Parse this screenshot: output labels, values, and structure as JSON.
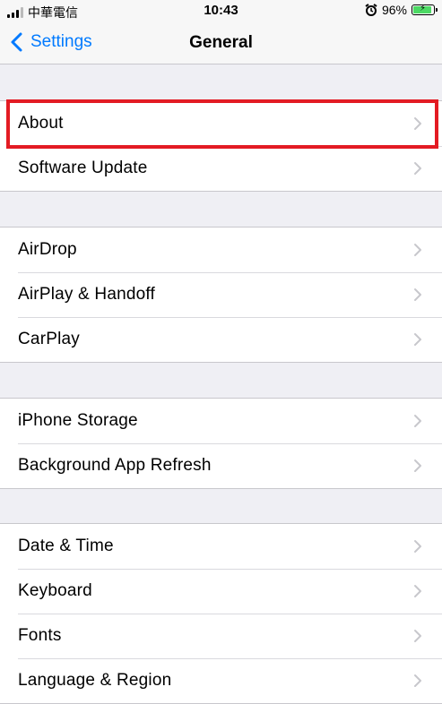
{
  "status_bar": {
    "carrier": "中華電信",
    "time": "10:43",
    "battery_percent": "96%",
    "battery_level": 0.96
  },
  "nav": {
    "back_label": "Settings",
    "title": "General"
  },
  "sections": [
    {
      "items": [
        {
          "label": "About"
        },
        {
          "label": "Software Update"
        }
      ]
    },
    {
      "items": [
        {
          "label": "AirDrop"
        },
        {
          "label": "AirPlay & Handoff"
        },
        {
          "label": "CarPlay"
        }
      ]
    },
    {
      "items": [
        {
          "label": "iPhone Storage"
        },
        {
          "label": "Background App Refresh"
        }
      ]
    },
    {
      "items": [
        {
          "label": "Date & Time"
        },
        {
          "label": "Keyboard"
        },
        {
          "label": "Fonts"
        },
        {
          "label": "Language & Region"
        }
      ]
    }
  ],
  "colors": {
    "accent": "#007aff",
    "highlight": "#e31b23",
    "background": "#efeff4",
    "battery_fill": "#4cd964"
  },
  "icons": [
    "signal-icon",
    "alarm-icon",
    "battery-icon",
    "back-chevron-icon",
    "chevron-right-icon"
  ]
}
